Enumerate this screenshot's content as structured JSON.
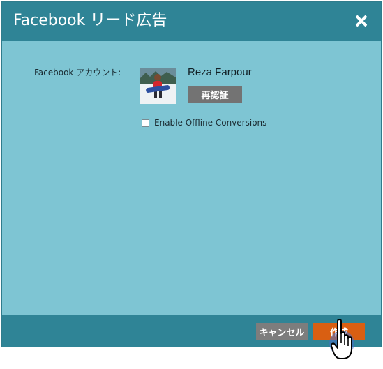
{
  "dialog": {
    "title": "Facebook リード広告",
    "close_icon": "close-icon"
  },
  "form": {
    "account_label": "Facebook アカウント:",
    "account_name": "Reza Farpour",
    "avatar_icon": "user-avatar-photo",
    "reauth_label": "再認証",
    "offline_conversions_label": "Enable Offline Conversions",
    "offline_conversions_checked": false
  },
  "footer": {
    "cancel_label": "キャンセル",
    "create_label": "作成"
  },
  "colors": {
    "header": "#2f8496",
    "body": "#7ec5d3",
    "primary_button": "#d95f12",
    "secondary_button": "#7d7d7d"
  }
}
